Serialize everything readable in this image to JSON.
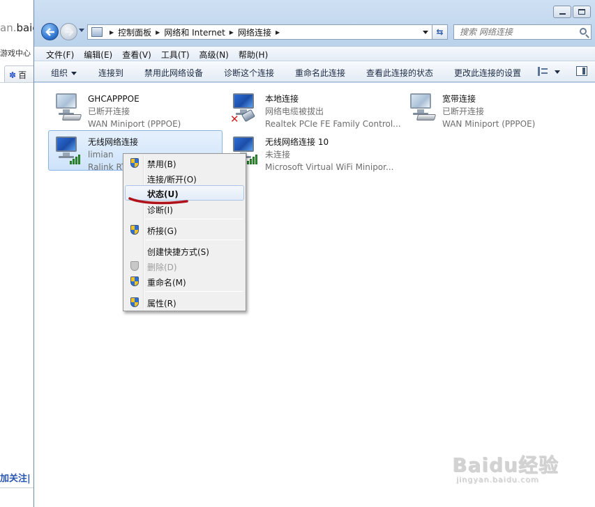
{
  "browser_bg": {
    "url_fragment_grey": "an.",
    "url_fragment_dark": "baic",
    "link_text": "游戏中心",
    "tab_label": "百",
    "bottom_text": "加关注|"
  },
  "window": {
    "breadcrumb": [
      "控制面板",
      "网络和 Internet",
      "网络连接"
    ],
    "search_placeholder": "搜索 网络连接"
  },
  "menu": [
    "文件(F)",
    "编辑(E)",
    "查看(V)",
    "工具(T)",
    "高级(N)",
    "帮助(H)"
  ],
  "commands": [
    "组织",
    "连接到",
    "禁用此网络设备",
    "诊断这个连接",
    "重命名此连接",
    "查看此连接的状态",
    "更改此连接的设置"
  ],
  "connections": [
    {
      "name": "GHCAPPPOE",
      "status": "已断开连接",
      "device": "WAN Miniport (PPPOE)"
    },
    {
      "name": "本地连接",
      "status": "网络电缆被拔出",
      "device": "Realtek PCIe FE Family Control..."
    },
    {
      "name": "宽带连接",
      "status": "已断开连接",
      "device": "WAN Miniport (PPPOE)"
    },
    {
      "name": "无线网络连接",
      "status": "limian",
      "device": "Ralink RT"
    },
    {
      "name": "无线网络连接 10",
      "status": "未连接",
      "device": "Microsoft Virtual WiFi Minipor..."
    }
  ],
  "context_menu": [
    {
      "label": "禁用(B)",
      "shield": true,
      "disabled": false
    },
    {
      "label": "连接/断开(O)",
      "shield": false,
      "disabled": false
    },
    {
      "label": "状态(U)",
      "shield": false,
      "disabled": false,
      "highlighted": true
    },
    {
      "label": "诊断(I)",
      "shield": false,
      "disabled": false
    },
    {
      "label": "桥接(G)",
      "shield": true,
      "disabled": false
    },
    {
      "label": "创建快捷方式(S)",
      "shield": false,
      "disabled": false
    },
    {
      "label": "删除(D)",
      "shield": true,
      "disabled": true
    },
    {
      "label": "重命名(M)",
      "shield": true,
      "disabled": false
    },
    {
      "label": "属性(R)",
      "shield": true,
      "disabled": false
    }
  ],
  "watermark": {
    "logo": "Baidu经验",
    "url": "jingyan.baidu.com"
  },
  "colors": {
    "annotation": "#b0121b",
    "selection": "#cde3fb",
    "accent": "#2a6fcc"
  }
}
